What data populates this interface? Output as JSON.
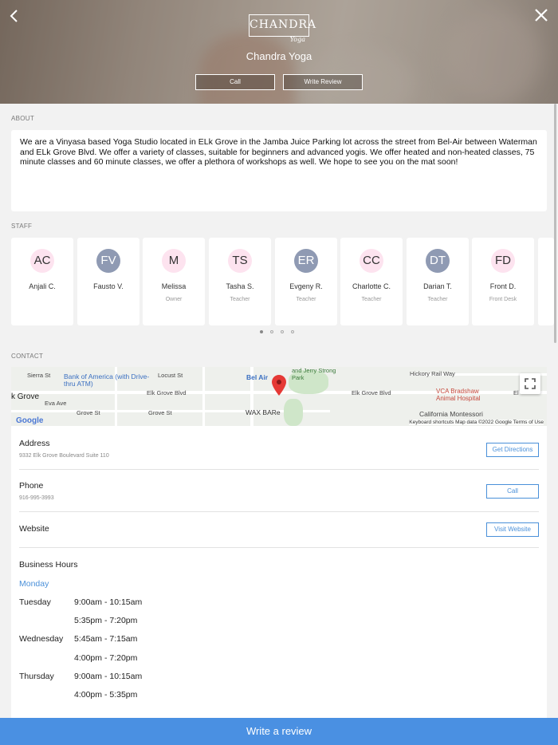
{
  "header": {
    "logo_text": "CHANDRA",
    "logo_script": "Yoga",
    "studio_name": "Chandra Yoga",
    "call_label": "Call",
    "review_label": "Write Review"
  },
  "about": {
    "label": "ABOUT",
    "text": "We are a Vinyasa based Yoga Studio located in ELk Grove in the Jamba Juice Parking lot across the street from Bel-Air between Waterman and ELk Grove Blvd.  We offer a variety of classes, suitable for beginners and advanced yogis. We offer heated and non-heated classes, 75 minute classes and 60 minute classes, we offer a plethora of workshops as well.  We hope to see you on the mat soon!"
  },
  "staff": {
    "label": "STAFF",
    "members": [
      {
        "initials": "AC",
        "name": "Anjali C.",
        "role": "",
        "color": "#fde3ef"
      },
      {
        "initials": "FV",
        "name": "Fausto V.",
        "role": "",
        "color": "#8f9ab3"
      },
      {
        "initials": "M",
        "name": "Melissa",
        "role": "Owner",
        "color": "#fde3ef"
      },
      {
        "initials": "TS",
        "name": "Tasha S.",
        "role": "Teacher",
        "color": "#fde3ef"
      },
      {
        "initials": "ER",
        "name": "Evgeny R.",
        "role": "Teacher",
        "color": "#8f9ab3"
      },
      {
        "initials": "CC",
        "name": "Charlotte C.",
        "role": "Teacher",
        "color": "#fde3ef"
      },
      {
        "initials": "DT",
        "name": "Darian T.",
        "role": "Teacher",
        "color": "#8f9ab3"
      },
      {
        "initials": "FD",
        "name": "Front D.",
        "role": "Front Desk",
        "color": "#fde3ef"
      }
    ],
    "page_count": 4,
    "current_page": 1
  },
  "contact": {
    "label": "CONTACT",
    "map": {
      "labels": [
        "Sierra St",
        "Bank of America (with Drive-thru ATM)",
        "Locust St",
        "Bel Air",
        "and Jerry Strong Park",
        "Hickory Rail Way",
        "k Grove",
        "Elk Grove Blvd",
        "Elk Grove Blvd",
        "VCA Bradshaw Animal Hospital",
        "Eva Ave",
        "Grove St",
        "Grove St",
        "WAX BARe",
        "California Montessori",
        "El"
      ],
      "footer": "Keyboard shortcuts   Map data ©2022 Google   Terms of Use",
      "google": "Google"
    },
    "address": {
      "title": "Address",
      "value": "9332 Elk Grove Boulevard Suite 110",
      "button": "Get Directions"
    },
    "phone": {
      "title": "Phone",
      "value": "916-995-3993",
      "button": "Call"
    },
    "website": {
      "title": "Website",
      "button": "Visit Website"
    },
    "hours": {
      "title": "Business Hours",
      "today": "Monday",
      "schedule": [
        {
          "day": "Tuesday",
          "times": [
            "9:00am - 10:15am",
            "5:35pm - 7:20pm"
          ]
        },
        {
          "day": "Wednesday",
          "times": [
            "5:45am - 7:15am",
            "4:00pm - 7:20pm"
          ]
        },
        {
          "day": "Thursday",
          "times": [
            "9:00am - 10:15am",
            "4:00pm - 5:35pm"
          ]
        }
      ]
    }
  },
  "footer": {
    "write_review": "Write a review"
  },
  "colors": {
    "accent": "#4a90e2",
    "link": "#4a90d9"
  }
}
